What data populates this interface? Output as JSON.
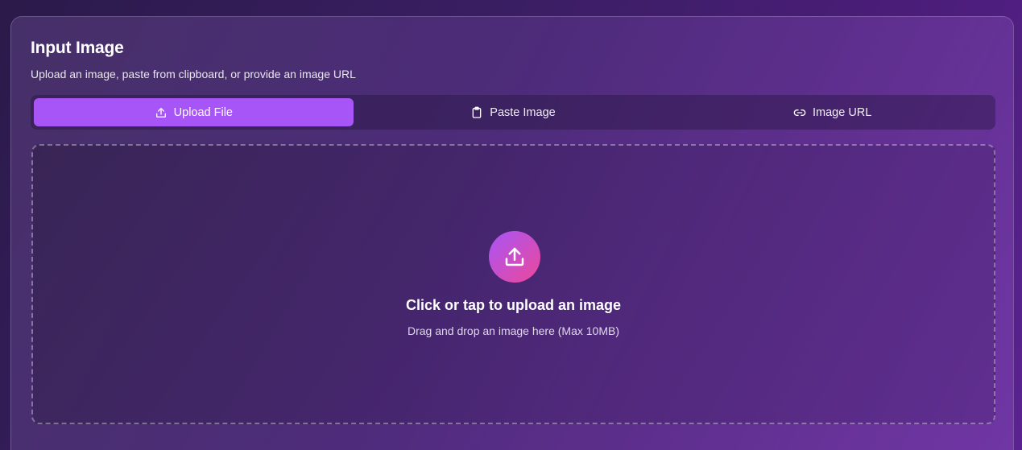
{
  "card": {
    "title": "Input Image",
    "subtitle": "Upload an image, paste from clipboard, or provide an image URL"
  },
  "tabs": [
    {
      "label": "Upload File",
      "icon": "upload-icon",
      "active": true
    },
    {
      "label": "Paste Image",
      "icon": "clipboard-icon",
      "active": false
    },
    {
      "label": "Image URL",
      "icon": "link-icon",
      "active": false
    }
  ],
  "dropzone": {
    "icon": "upload-icon",
    "title": "Click or tap to upload an image",
    "subtitle": "Drag and drop an image here (Max 10MB)"
  },
  "colors": {
    "accent": "#a855f7",
    "gradient_end": "#ec4899"
  }
}
